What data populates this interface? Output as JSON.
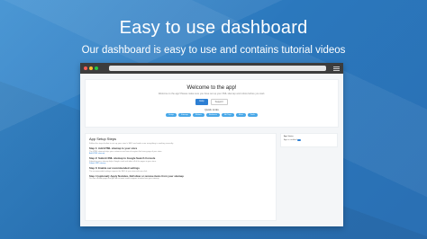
{
  "hero": {
    "title": "Easy to use dashboard",
    "subtitle": "Our dashboard is easy to use and contains tutorial videos"
  },
  "colors": {
    "background": "#2f7cc0",
    "primary": "#2d7fd3",
    "quick_link": "#49a8e8",
    "dot_red": "#ff5f57",
    "dot_yellow": "#febc2e",
    "dot_green": "#28c840"
  },
  "browser": {
    "icons": [
      "close-dot",
      "minimize-dot",
      "maximize-dot",
      "hamburger-menu-icon"
    ]
  },
  "welcome": {
    "title": "Welcome to the app!",
    "text": "Welcome to the app! Please make sure you have set up your XML sitemap and robots before you start.",
    "primary_button": "Help",
    "secondary_button": "Support",
    "quick_links_title": "Quick Links",
    "quick_links": [
      "Setup",
      "Sitemap",
      "Robots",
      "Redirects",
      "Alt Tags",
      "Meta",
      "Tools"
    ]
  },
  "setup": {
    "title": "App Setup Steps",
    "description": "Follow the steps below to set up your store's SEO and make sure everything is working correctly.",
    "steps": [
      {
        "title": "Step 1: Add HTML sitemap to your store",
        "text": "The HTML sitemap helps your customers and search engines find every page of your store.",
        "link": "Add HTML sitemap"
      },
      {
        "title": "Step 2: Submit XML sitemap to Google Search Console",
        "text": "Submitting your sitemap helps Google crawl and index all of the pages in your store.",
        "link": "Submit XML sitemap"
      },
      {
        "title": "Step 3: Enable our recommended settings",
        "text": "The recommended settings improve the SEO of your store with one click.",
        "link": ""
      },
      {
        "title": "Step 4 (optional): Apply Noindex, NoFollow or remove items from your sitemap",
        "text": "You can exclude pages that you do not want search engines to index from your sitemap.",
        "link": ""
      }
    ]
  },
  "side": {
    "label": "App Status",
    "row": "App is enabled"
  }
}
